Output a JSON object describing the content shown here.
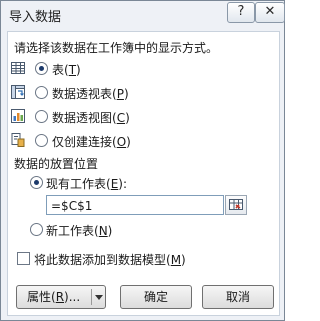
{
  "window": {
    "title": "导入数据",
    "help_label": "?",
    "close_label": "✕"
  },
  "display_section": {
    "prompt": "请选择该数据在工作簿中的显示方式。",
    "options": [
      {
        "label": "表(",
        "key": "T",
        "suffix": ")",
        "selected": true,
        "icon": "table-icon"
      },
      {
        "label": "数据透视表(",
        "key": "P",
        "suffix": ")",
        "selected": false,
        "icon": "pivot-table-icon"
      },
      {
        "label": "数据透视图(",
        "key": "C",
        "suffix": ")",
        "selected": false,
        "icon": "pivot-chart-icon"
      },
      {
        "label": "仅创建连接(",
        "key": "O",
        "suffix": ")",
        "selected": false,
        "icon": "connection-icon"
      }
    ]
  },
  "placement_section": {
    "heading": "数据的放置位置",
    "existing_sheet": {
      "label": "现有工作表(",
      "key": "E",
      "suffix": "):",
      "selected": true
    },
    "range_value": "=$C$1",
    "new_sheet": {
      "label": "新工作表(",
      "key": "N",
      "suffix": ")",
      "selected": false
    }
  },
  "data_model": {
    "label": "将此数据添加到数据模型(",
    "key": "M",
    "suffix": ")",
    "checked": false
  },
  "buttons": {
    "properties": {
      "label": "属性(",
      "key": "R",
      "suffix": ")..."
    },
    "ok": "确定",
    "cancel": "取消"
  },
  "colors": {
    "accent": "#1c3a6b",
    "border": "#7f9db9",
    "background": "#eef1f6"
  }
}
